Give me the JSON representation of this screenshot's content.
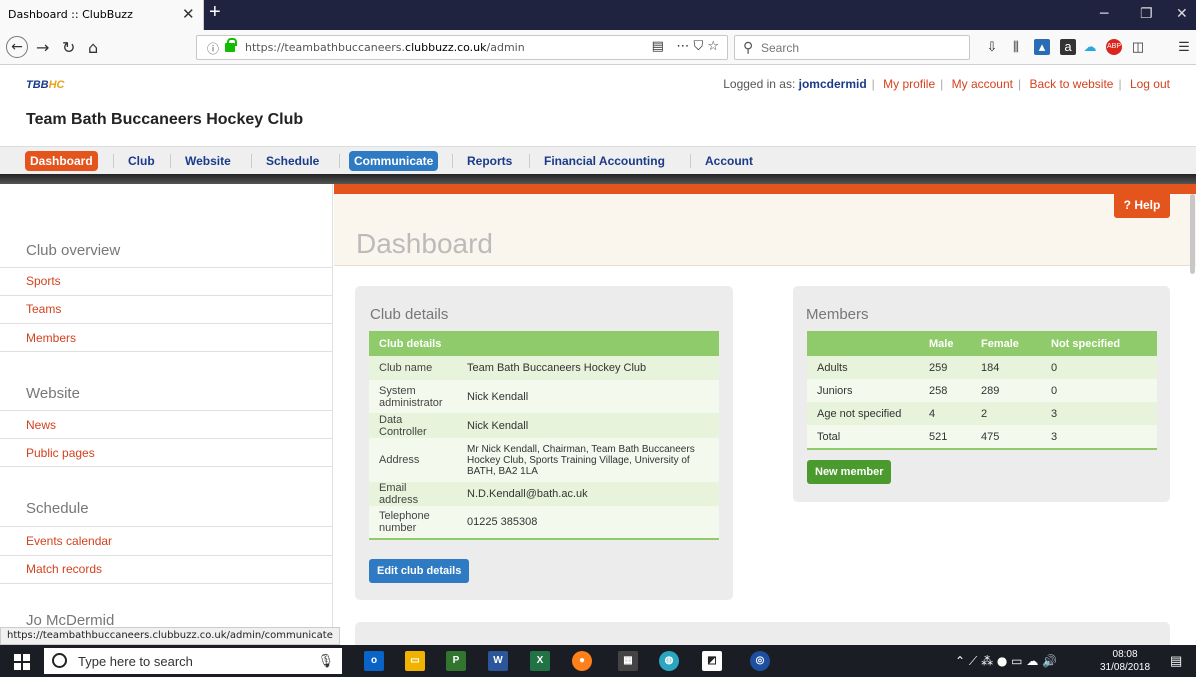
{
  "browser": {
    "tab_title": "Dashboard :: ClubBuzz",
    "url_prefix": "https://teambathbuccaneers.",
    "url_domain": "clubbuzz.co.uk",
    "url_path": "/admin",
    "search_placeholder": "Search",
    "url_actions": "⋯ ⛉ ☆",
    "status_url": "https://teambathbuccaneers.clubbuzz.co.uk/admin/communicate"
  },
  "site": {
    "logo_text": "TBB",
    "logo_suffix": "HC",
    "club_name": "Team Bath Buccaneers Hockey Club",
    "logged_in_label": "Logged in as:",
    "username": "jomcdermid",
    "user_links": [
      "My profile",
      "My account",
      "Back to website",
      "Log out"
    ]
  },
  "menu": [
    "Dashboard",
    "Club",
    "Website",
    "Schedule",
    "Communicate",
    "Reports",
    "Financial Accounting",
    "Account"
  ],
  "sidebar": {
    "sections": [
      {
        "heading": "Club overview",
        "links": [
          "Sports",
          "Teams",
          "Members"
        ]
      },
      {
        "heading": "Website",
        "links": [
          "News",
          "Public pages"
        ]
      },
      {
        "heading": "Schedule",
        "links": [
          "Events calendar",
          "Match records"
        ]
      }
    ],
    "partial_heading": "Jo McDermid"
  },
  "page": {
    "title": "Dashboard",
    "help_label": "? Help"
  },
  "club_details": {
    "panel_title": "Club details",
    "table_header": "Club details",
    "rows": [
      {
        "label": "Club name",
        "value": "Team Bath Buccaneers Hockey Club"
      },
      {
        "label": "System administrator",
        "value": "Nick Kendall"
      },
      {
        "label": "Data Controller",
        "value": "Nick Kendall"
      },
      {
        "label": "Address",
        "value": "Mr Nick Kendall, Chairman, Team Bath Buccaneers Hockey Club, Sports Training Village, University of BATH, BA2 1LA"
      },
      {
        "label": "Email address",
        "value": "N.D.Kendall@bath.ac.uk"
      },
      {
        "label": "Telephone number",
        "value": "01225 385308"
      }
    ],
    "edit_button": "Edit club details"
  },
  "members": {
    "panel_title": "Members",
    "columns": [
      "",
      "Male",
      "Female",
      "Not specified"
    ],
    "rows": [
      [
        "Adults",
        "259",
        "184",
        "0"
      ],
      [
        "Juniors",
        "258",
        "289",
        "0"
      ],
      [
        "Age not specified",
        "4",
        "2",
        "3"
      ],
      [
        "Total",
        "521",
        "475",
        "3"
      ]
    ],
    "new_button": "New member"
  },
  "taskbar": {
    "search_placeholder": "Type here to search",
    "time": "08:08",
    "date": "31/08/2018"
  }
}
